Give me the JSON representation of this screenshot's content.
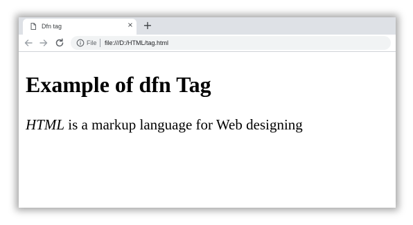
{
  "browser": {
    "tab": {
      "title": "Dfn tag",
      "favicon": "document-icon",
      "close_glyph": "×"
    },
    "new_tab_glyph": "+",
    "toolbar": {
      "back_icon": "back-arrow-icon",
      "forward_icon": "forward-arrow-icon",
      "reload_icon": "reload-icon",
      "site_info_icon": "info-icon",
      "scheme_label": "File",
      "url": "file:///D:/HTML/tag.html"
    },
    "colors": {
      "tabstrip_bg": "#dee1e6",
      "omnibox_bg": "#f1f3f4",
      "icon_color": "#5f6368"
    }
  },
  "page": {
    "heading": "Example of dfn Tag",
    "paragraph": {
      "term": "HTML",
      "rest": " is a markup language for Web designing"
    }
  }
}
